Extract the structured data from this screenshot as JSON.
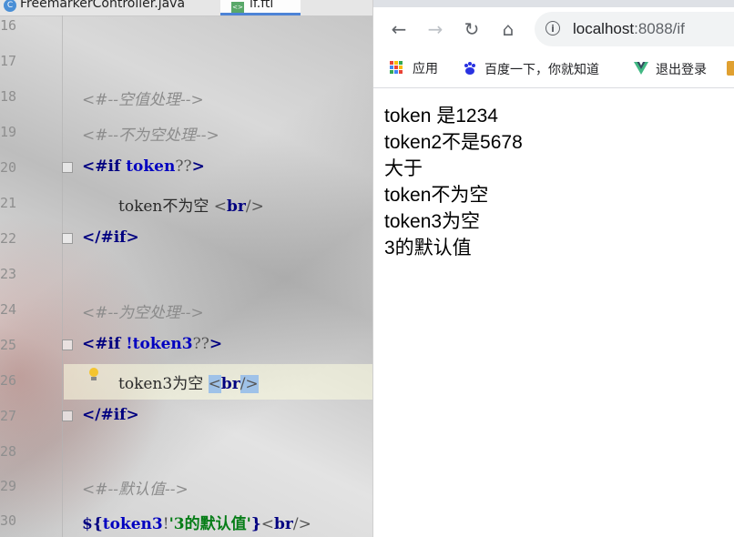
{
  "editor": {
    "tabs": [
      {
        "label": "FreemarkerController.java",
        "icon": "java-class-icon"
      },
      {
        "label": "if.ftl",
        "icon": "ftl-file-icon"
      }
    ],
    "lines": [
      {
        "num": "16"
      },
      {
        "num": "17"
      },
      {
        "num": "18",
        "comment": "<#--空值处理-->"
      },
      {
        "num": "19",
        "comment": "<#--不为空处理-->"
      },
      {
        "num": "20",
        "open": "<#if ",
        "var": "token",
        "op": "??",
        "close": ">"
      },
      {
        "num": "21",
        "text": "token不为空 ",
        "tag_open": "<",
        "tag": "br",
        "tag_close": "/>"
      },
      {
        "num": "22",
        "tag": "</#if>"
      },
      {
        "num": "23"
      },
      {
        "num": "24",
        "comment": "<#--为空处理-->"
      },
      {
        "num": "25",
        "open": "<#if ",
        "var": "!token3",
        "op": "??",
        "close": ">"
      },
      {
        "num": "26",
        "text": "token3为空 ",
        "tag_open": "<",
        "tag": "br",
        "tag_close": "/>"
      },
      {
        "num": "27",
        "tag": "</#if>"
      },
      {
        "num": "28"
      },
      {
        "num": "29",
        "comment": "<#--默认值-->"
      },
      {
        "num": "30",
        "interp": "${",
        "var": "token3",
        "bang": "!",
        "str": "'3的默认值'",
        "rbrace": "}",
        "tag_open": "<",
        "tag": "br",
        "tag_close": "/>"
      }
    ]
  },
  "browser": {
    "nav": {
      "back": "←",
      "forward": "→",
      "reload": "↻",
      "home": "⌂"
    },
    "url_host": "localhost",
    "url_rest": ":8088/if",
    "bookmarks": [
      {
        "label": "应用",
        "icon": "apps-grid-icon"
      },
      {
        "label": "百度一下，你就知道",
        "icon": "baidu-paw-icon"
      },
      {
        "label": "退出登录",
        "icon": "vue-logo-icon"
      }
    ],
    "content": [
      "token 是1234",
      "token2不是5678",
      "大于",
      "token不为空",
      "token3为空",
      "3的默认值"
    ]
  },
  "colors": {
    "keyword": "#000080",
    "variable": "#0000c0",
    "comment": "#8c8c8c",
    "string": "#067d17",
    "selection": "#9fc2e8"
  }
}
